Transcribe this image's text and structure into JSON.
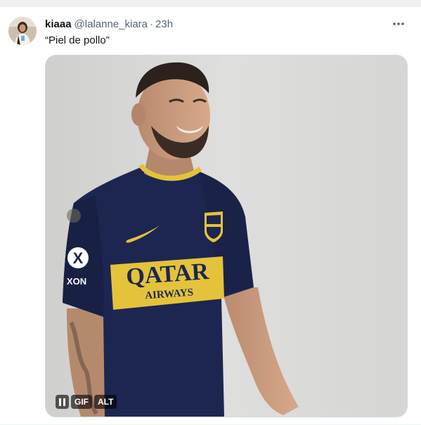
{
  "tweet": {
    "display_name": "kiaaa",
    "handle": "@lalanne_kiara",
    "separator": "·",
    "time": "23h",
    "text": "“Piel de pollo”",
    "avatar_icon": "profile-photo",
    "more_icon": "more-horizontal-icon"
  },
  "media": {
    "type": "gif",
    "jersey_text_line1": "QATAR",
    "jersey_text_line2": "AIRWAYS",
    "controls": {
      "pause_icon": "pause-icon",
      "gif_label": "GIF",
      "alt_label": "ALT"
    }
  },
  "colors": {
    "text_primary": "#0f1419",
    "text_secondary": "#536471",
    "border": "#cfd9de",
    "jersey_navy": "#1d2650",
    "jersey_gold": "#e4c33b"
  }
}
